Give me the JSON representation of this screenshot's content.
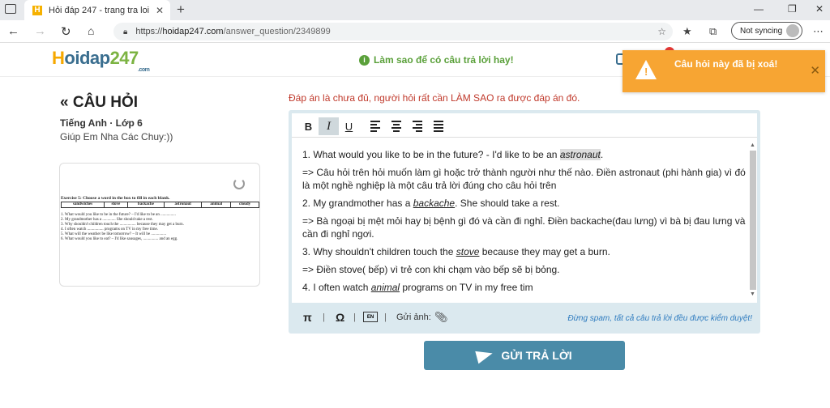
{
  "browser": {
    "tab_title": "Hỏi đáp 247 - trang tra loi",
    "tab_close": "✕",
    "new_tab": "+",
    "url_prefix": "https://",
    "url_host": "hoidap247.com",
    "url_path": "/answer_question/2349899",
    "sync_label": "Not syncing",
    "window_controls": {
      "minimize": "—",
      "restore": "❐",
      "close": "✕"
    },
    "icons": [
      "back-icon",
      "forward-icon",
      "reload-icon",
      "home-icon",
      "lock-icon",
      "favorites-add-icon",
      "favorites-icon",
      "collections-icon",
      "more-icon"
    ]
  },
  "site": {
    "logo_h": "H",
    "logo_text": "oidap",
    "logo_num": "247",
    "logo_com": ".com",
    "tip_text": "Làm sao để có câu trả lời hay!"
  },
  "toast": {
    "message": "Câu hỏi này đã bị xoá!",
    "color": "#f7a533"
  },
  "question": {
    "title": "« CÂU HỎI",
    "subject": "Tiếng Anh · Lớp 6",
    "body": "Giúp Em Nha Các Chuy:))",
    "doc": {
      "exercise": "Exercise 5: Choose a word in the box to fill in each blank.",
      "words": [
        "sandwiches",
        "stove",
        "backache",
        "astronaut",
        "animal",
        "cloudy"
      ],
      "lines": [
        "1. What would you like to be in the future? – I'd like to be an ...............",
        "2. My grandmother has a ............. She should take a rest.",
        "3. Why shouldn't children touch the ................ because they may get a burn.",
        "4. I often watch ................ programs on TV in my free time.",
        "5. What will the weather be like tomorrow? – It will be ...............",
        "6. What would you like to eat? – I'd like sausages, ............... and an egg."
      ]
    }
  },
  "answer": {
    "note": "Đáp án là chưa đủ, người hỏi rất cần LÀM SAO ra được đáp án đó.",
    "toolbar": {
      "bold": "B",
      "italic": "I",
      "underline": "U"
    },
    "p1_pre": "1. What would you like  to be in the future? - I'd like to be an ",
    "p1_word": "astronaut",
    "p1_post": ".",
    "p2": "=> Câu hỏi trên hỏi muốn làm gì hoặc trở thành người như thế nào. Điền astronaut (phi hành gia) vì đó là một nghề nghiệp là một câu trả lời đúng cho câu hỏi trên",
    "p3_pre": "2. My grandmother has a ",
    "p3_word": "backache",
    "p3_post": ". She should take a rest.",
    "p4": "=> Bà ngoại bị mệt mỏi hay bị bệnh gì đó và cần đi nghỉ. Điền backache(đau lưng) vì bà bị đau lưng và cần đi nghỉ ngơi.",
    "p5_pre": "3. Why shouldn't children touch the ",
    "p5_word": "stove",
    "p5_post": " because they may get a burn.",
    "p6": "=> Điền stove( bếp) vì trẻ con khi chạm vào bếp sẽ bị bỏng.",
    "p7_pre": "4. I often watch ",
    "p7_word": "animal",
    "p7_post": " programs on TV in my free tim",
    "footer": {
      "pi": "π",
      "omega": "Ω",
      "en": "EN",
      "sep": "|",
      "image_label": "Gửi ảnh:",
      "warning": "Đừng spam, tất cả câu trả lời đều được kiểm duyệt!"
    },
    "submit_label": "GỬI TRẢ LỜI"
  }
}
